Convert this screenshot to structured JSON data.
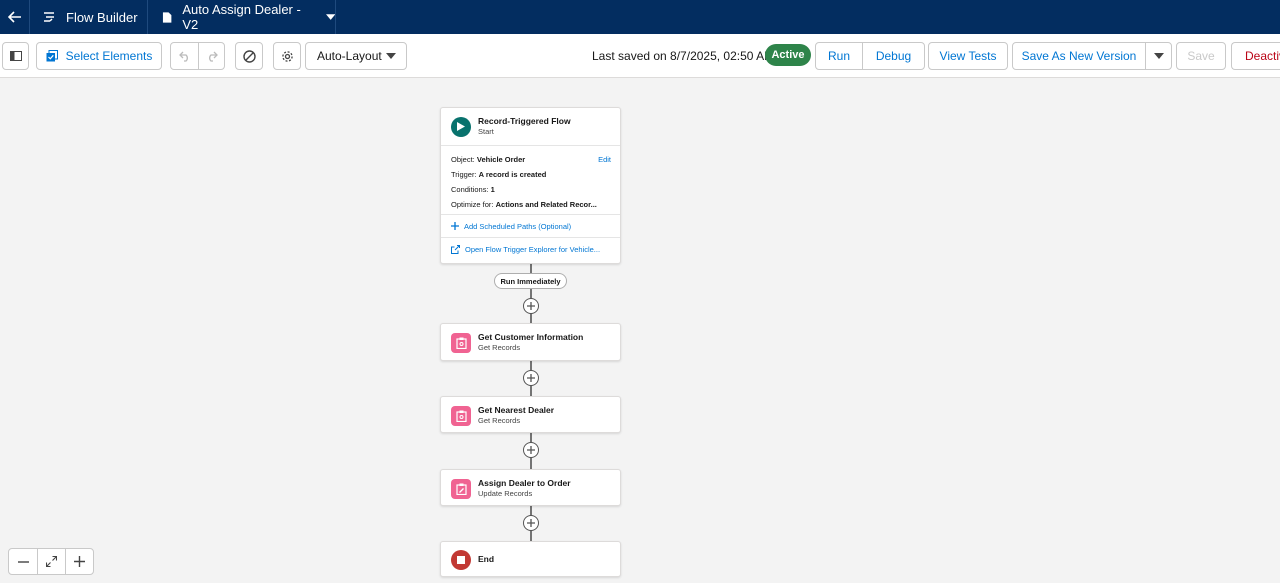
{
  "header": {
    "back_icon": "arrow-left-icon",
    "app_name": "Flow Builder",
    "file_name": "Auto Assign Dealer - V2"
  },
  "toolbar": {
    "select_elements": "Select Elements",
    "layout_mode": "Auto-Layout",
    "last_saved": "Last saved on 8/7/2025, 02:50 AM",
    "status": "Active",
    "run": "Run",
    "debug": "Debug",
    "view_tests": "View Tests",
    "save_as_new_version": "Save As New Version",
    "save": "Save",
    "deactivate": "Deactiv"
  },
  "flow": {
    "start": {
      "title": "Record-Triggered Flow",
      "subtitle": "Start",
      "object_label": "Object:",
      "object_value": "Vehicle Order",
      "edit": "Edit",
      "trigger_label": "Trigger:",
      "trigger_value": "A record is created",
      "conditions_label": "Conditions:",
      "conditions_value": "1",
      "optimize_label": "Optimize for:",
      "optimize_value": "Actions and Related Recor...",
      "add_scheduled_paths": "Add Scheduled Paths (Optional)",
      "open_trigger_explorer": "Open Flow Trigger Explorer for Vehicle..."
    },
    "path_label": "Run Immediately",
    "elements": [
      {
        "title": "Get Customer Information",
        "subtitle": "Get Records"
      },
      {
        "title": "Get Nearest Dealer",
        "subtitle": "Get Records"
      },
      {
        "title": "Assign Dealer to Order",
        "subtitle": "Update Records"
      }
    ],
    "end": {
      "title": "End"
    }
  },
  "colors": {
    "header_bg": "#032d60",
    "brand_blue": "#0176d3",
    "active_green": "#2e844a",
    "record_pink": "#f06392",
    "start_teal": "#08726d",
    "end_red": "#c23934"
  }
}
